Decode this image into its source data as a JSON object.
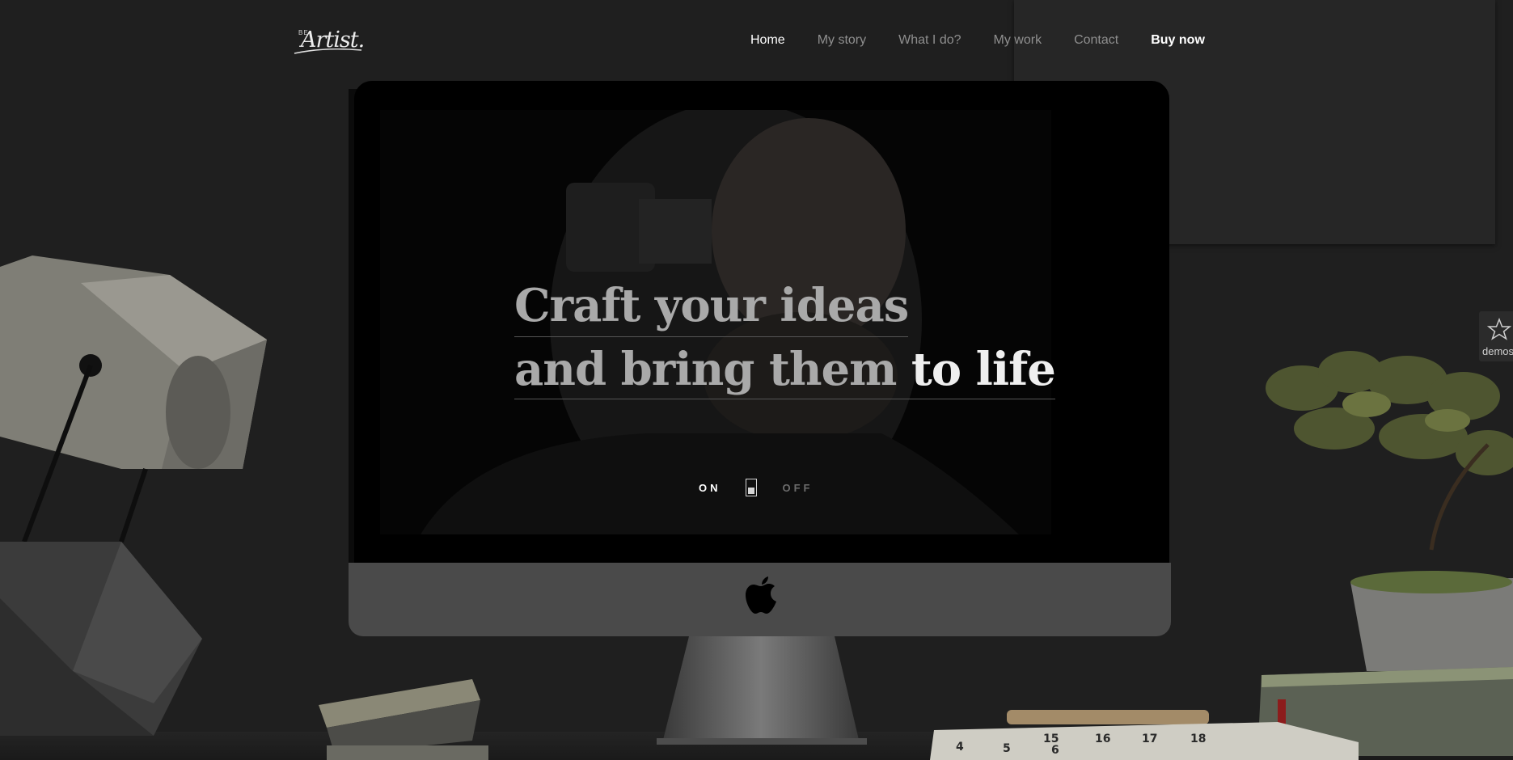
{
  "logo": {
    "small": "BE",
    "script": "Artist."
  },
  "nav": {
    "items": [
      "Home",
      "My story",
      "What I do?",
      "My work",
      "Contact"
    ],
    "buy": "Buy now"
  },
  "hero": {
    "line1": "Craft your ideas",
    "line2_a": "and bring them ",
    "line2_b": "to life"
  },
  "toggle": {
    "on": "ON",
    "off": "OFF"
  },
  "side": {
    "demos": "demos"
  },
  "tape": [
    "4",
    "5",
    "6",
    "15",
    "16",
    "17",
    "18"
  ],
  "colors": {
    "background": "#1f1f1f",
    "chin": "#4a4a4a",
    "accent_text": "#efefef"
  }
}
